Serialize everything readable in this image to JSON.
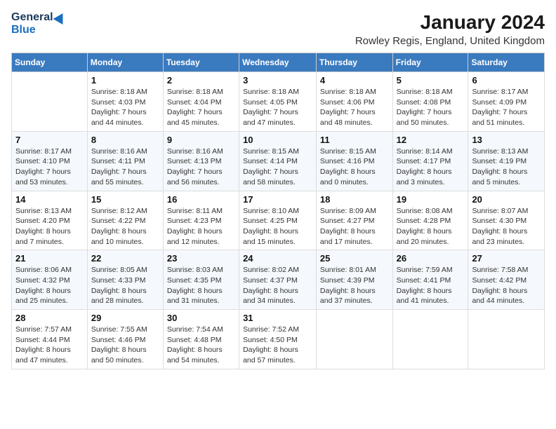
{
  "header": {
    "logo_general": "General",
    "logo_blue": "Blue",
    "month_title": "January 2024",
    "location": "Rowley Regis, England, United Kingdom"
  },
  "days_of_week": [
    "Sunday",
    "Monday",
    "Tuesday",
    "Wednesday",
    "Thursday",
    "Friday",
    "Saturday"
  ],
  "weeks": [
    [
      {
        "num": "",
        "sunrise": "",
        "sunset": "",
        "daylight": ""
      },
      {
        "num": "1",
        "sunrise": "Sunrise: 8:18 AM",
        "sunset": "Sunset: 4:03 PM",
        "daylight": "Daylight: 7 hours and 44 minutes."
      },
      {
        "num": "2",
        "sunrise": "Sunrise: 8:18 AM",
        "sunset": "Sunset: 4:04 PM",
        "daylight": "Daylight: 7 hours and 45 minutes."
      },
      {
        "num": "3",
        "sunrise": "Sunrise: 8:18 AM",
        "sunset": "Sunset: 4:05 PM",
        "daylight": "Daylight: 7 hours and 47 minutes."
      },
      {
        "num": "4",
        "sunrise": "Sunrise: 8:18 AM",
        "sunset": "Sunset: 4:06 PM",
        "daylight": "Daylight: 7 hours and 48 minutes."
      },
      {
        "num": "5",
        "sunrise": "Sunrise: 8:18 AM",
        "sunset": "Sunset: 4:08 PM",
        "daylight": "Daylight: 7 hours and 50 minutes."
      },
      {
        "num": "6",
        "sunrise": "Sunrise: 8:17 AM",
        "sunset": "Sunset: 4:09 PM",
        "daylight": "Daylight: 7 hours and 51 minutes."
      }
    ],
    [
      {
        "num": "7",
        "sunrise": "Sunrise: 8:17 AM",
        "sunset": "Sunset: 4:10 PM",
        "daylight": "Daylight: 7 hours and 53 minutes."
      },
      {
        "num": "8",
        "sunrise": "Sunrise: 8:16 AM",
        "sunset": "Sunset: 4:11 PM",
        "daylight": "Daylight: 7 hours and 55 minutes."
      },
      {
        "num": "9",
        "sunrise": "Sunrise: 8:16 AM",
        "sunset": "Sunset: 4:13 PM",
        "daylight": "Daylight: 7 hours and 56 minutes."
      },
      {
        "num": "10",
        "sunrise": "Sunrise: 8:15 AM",
        "sunset": "Sunset: 4:14 PM",
        "daylight": "Daylight: 7 hours and 58 minutes."
      },
      {
        "num": "11",
        "sunrise": "Sunrise: 8:15 AM",
        "sunset": "Sunset: 4:16 PM",
        "daylight": "Daylight: 8 hours and 0 minutes."
      },
      {
        "num": "12",
        "sunrise": "Sunrise: 8:14 AM",
        "sunset": "Sunset: 4:17 PM",
        "daylight": "Daylight: 8 hours and 3 minutes."
      },
      {
        "num": "13",
        "sunrise": "Sunrise: 8:13 AM",
        "sunset": "Sunset: 4:19 PM",
        "daylight": "Daylight: 8 hours and 5 minutes."
      }
    ],
    [
      {
        "num": "14",
        "sunrise": "Sunrise: 8:13 AM",
        "sunset": "Sunset: 4:20 PM",
        "daylight": "Daylight: 8 hours and 7 minutes."
      },
      {
        "num": "15",
        "sunrise": "Sunrise: 8:12 AM",
        "sunset": "Sunset: 4:22 PM",
        "daylight": "Daylight: 8 hours and 10 minutes."
      },
      {
        "num": "16",
        "sunrise": "Sunrise: 8:11 AM",
        "sunset": "Sunset: 4:23 PM",
        "daylight": "Daylight: 8 hours and 12 minutes."
      },
      {
        "num": "17",
        "sunrise": "Sunrise: 8:10 AM",
        "sunset": "Sunset: 4:25 PM",
        "daylight": "Daylight: 8 hours and 15 minutes."
      },
      {
        "num": "18",
        "sunrise": "Sunrise: 8:09 AM",
        "sunset": "Sunset: 4:27 PM",
        "daylight": "Daylight: 8 hours and 17 minutes."
      },
      {
        "num": "19",
        "sunrise": "Sunrise: 8:08 AM",
        "sunset": "Sunset: 4:28 PM",
        "daylight": "Daylight: 8 hours and 20 minutes."
      },
      {
        "num": "20",
        "sunrise": "Sunrise: 8:07 AM",
        "sunset": "Sunset: 4:30 PM",
        "daylight": "Daylight: 8 hours and 23 minutes."
      }
    ],
    [
      {
        "num": "21",
        "sunrise": "Sunrise: 8:06 AM",
        "sunset": "Sunset: 4:32 PM",
        "daylight": "Daylight: 8 hours and 25 minutes."
      },
      {
        "num": "22",
        "sunrise": "Sunrise: 8:05 AM",
        "sunset": "Sunset: 4:33 PM",
        "daylight": "Daylight: 8 hours and 28 minutes."
      },
      {
        "num": "23",
        "sunrise": "Sunrise: 8:03 AM",
        "sunset": "Sunset: 4:35 PM",
        "daylight": "Daylight: 8 hours and 31 minutes."
      },
      {
        "num": "24",
        "sunrise": "Sunrise: 8:02 AM",
        "sunset": "Sunset: 4:37 PM",
        "daylight": "Daylight: 8 hours and 34 minutes."
      },
      {
        "num": "25",
        "sunrise": "Sunrise: 8:01 AM",
        "sunset": "Sunset: 4:39 PM",
        "daylight": "Daylight: 8 hours and 37 minutes."
      },
      {
        "num": "26",
        "sunrise": "Sunrise: 7:59 AM",
        "sunset": "Sunset: 4:41 PM",
        "daylight": "Daylight: 8 hours and 41 minutes."
      },
      {
        "num": "27",
        "sunrise": "Sunrise: 7:58 AM",
        "sunset": "Sunset: 4:42 PM",
        "daylight": "Daylight: 8 hours and 44 minutes."
      }
    ],
    [
      {
        "num": "28",
        "sunrise": "Sunrise: 7:57 AM",
        "sunset": "Sunset: 4:44 PM",
        "daylight": "Daylight: 8 hours and 47 minutes."
      },
      {
        "num": "29",
        "sunrise": "Sunrise: 7:55 AM",
        "sunset": "Sunset: 4:46 PM",
        "daylight": "Daylight: 8 hours and 50 minutes."
      },
      {
        "num": "30",
        "sunrise": "Sunrise: 7:54 AM",
        "sunset": "Sunset: 4:48 PM",
        "daylight": "Daylight: 8 hours and 54 minutes."
      },
      {
        "num": "31",
        "sunrise": "Sunrise: 7:52 AM",
        "sunset": "Sunset: 4:50 PM",
        "daylight": "Daylight: 8 hours and 57 minutes."
      },
      {
        "num": "",
        "sunrise": "",
        "sunset": "",
        "daylight": ""
      },
      {
        "num": "",
        "sunrise": "",
        "sunset": "",
        "daylight": ""
      },
      {
        "num": "",
        "sunrise": "",
        "sunset": "",
        "daylight": ""
      }
    ]
  ]
}
